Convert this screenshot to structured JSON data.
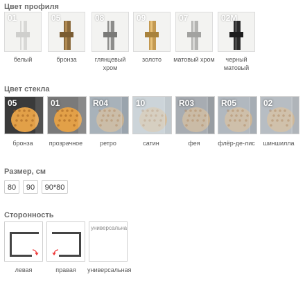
{
  "profile": {
    "title": "Цвет профиля",
    "items": [
      {
        "code": "01",
        "label": "белый",
        "color": "#d8d8d6"
      },
      {
        "code": "05",
        "label": "бронза",
        "color": "#8a6a3c"
      },
      {
        "code": "08",
        "label": "глянцевый хром",
        "color": "#9a9a98"
      },
      {
        "code": "09",
        "label": "золото",
        "color": "#c49a52"
      },
      {
        "code": "07",
        "label": "матовый хром",
        "color": "#b4b4b2"
      },
      {
        "code": "02M",
        "label": "черный матовый",
        "color": "#2a2a2a"
      }
    ]
  },
  "glass": {
    "title": "Цвет стекла",
    "items": [
      {
        "code": "05",
        "label": "бронза",
        "tint": "#3a3a3a"
      },
      {
        "code": "01",
        "label": "прозрачное",
        "tint": "#7a7a7a"
      },
      {
        "code": "R04",
        "label": "ретро",
        "tint": "#8d98a2"
      },
      {
        "code": "10",
        "label": "сатин",
        "tint": "#b9c2c8"
      },
      {
        "code": "R03",
        "label": "фея",
        "tint": "#8a9096"
      },
      {
        "code": "R05",
        "label": "флёр-де-лис",
        "tint": "#9aa2aa"
      },
      {
        "code": "02",
        "label": "шиншилла",
        "tint": "#a4aab0"
      }
    ]
  },
  "size": {
    "title": "Размер, см",
    "options": [
      "80",
      "90",
      "90*80"
    ]
  },
  "side": {
    "title": "Сторонность",
    "items": [
      {
        "label": "левая"
      },
      {
        "label": "правая"
      },
      {
        "label": "универсальная",
        "alt": "универсальная"
      }
    ]
  }
}
